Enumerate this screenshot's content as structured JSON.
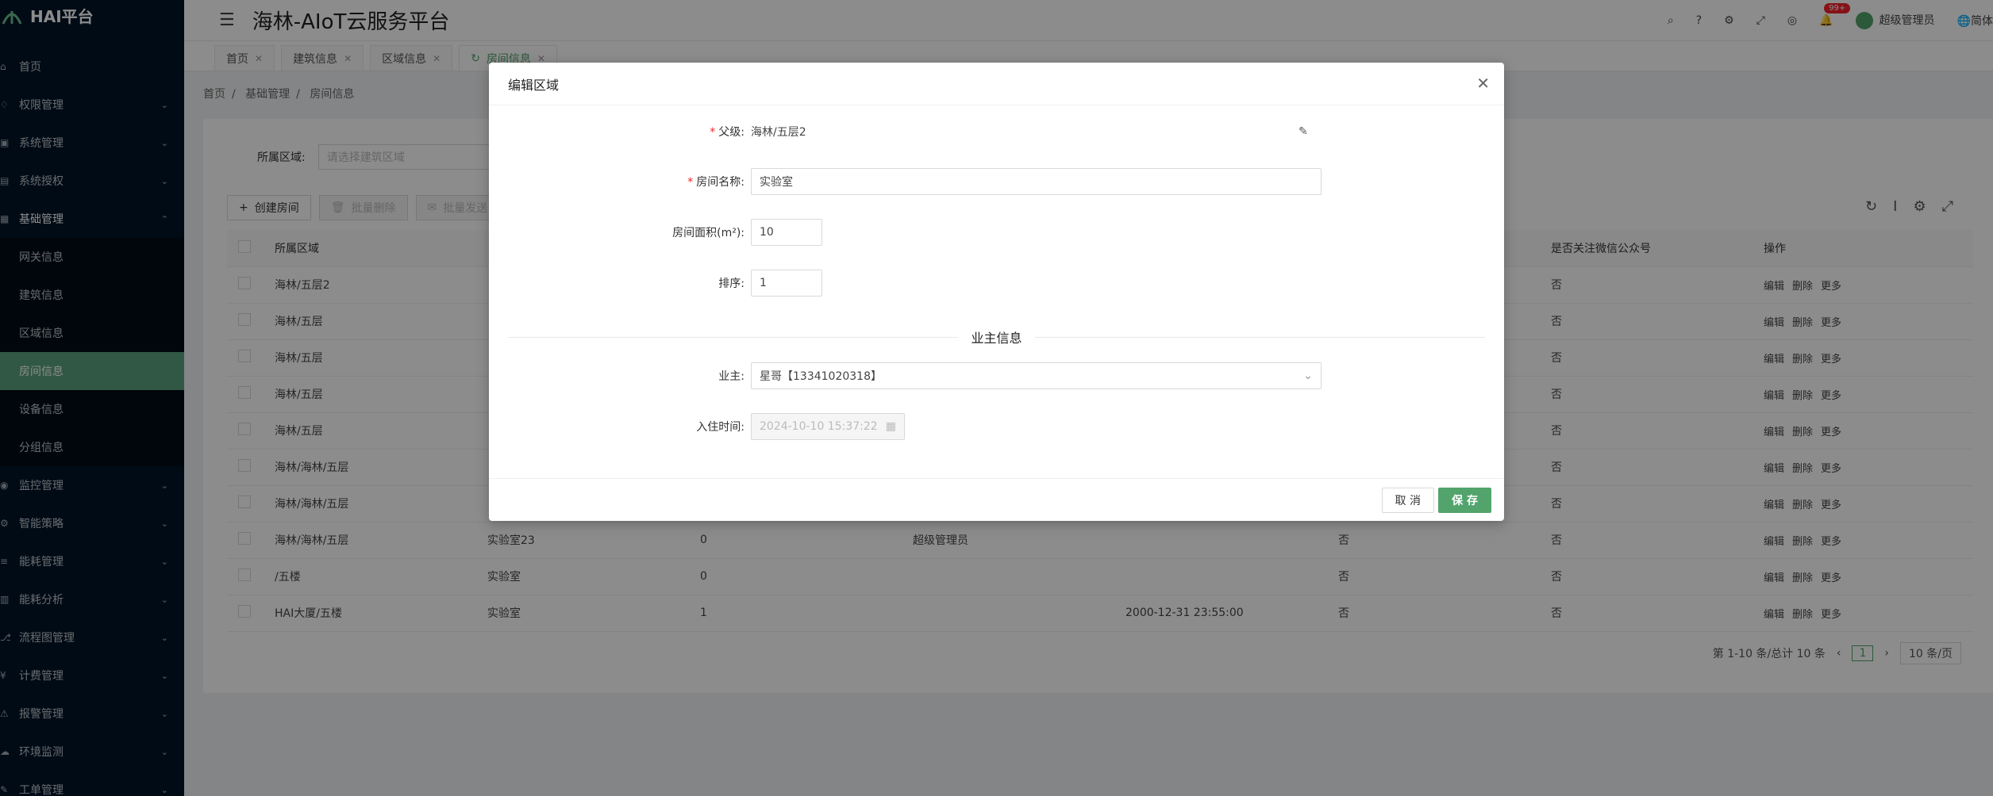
{
  "app": {
    "logo_text": "HAI平台",
    "title": "海林-AIoT云服务平台"
  },
  "header": {
    "user": "超级管理员",
    "notif_count": "99+",
    "lang": "简体"
  },
  "sidebar": {
    "items": [
      {
        "label": "首页"
      },
      {
        "label": "权限管理"
      },
      {
        "label": "系统管理"
      },
      {
        "label": "系统授权"
      },
      {
        "label": "基础管理"
      }
    ],
    "sub_items": [
      {
        "label": "网关信息"
      },
      {
        "label": "建筑信息"
      },
      {
        "label": "区域信息"
      },
      {
        "label": "房间信息"
      },
      {
        "label": "设备信息"
      },
      {
        "label": "分组信息"
      }
    ],
    "items_after": [
      {
        "label": "监控管理"
      },
      {
        "label": "智能策略"
      },
      {
        "label": "能耗管理"
      },
      {
        "label": "能耗分析"
      },
      {
        "label": "流程图管理"
      },
      {
        "label": "计费管理"
      },
      {
        "label": "报警管理"
      },
      {
        "label": "环境监测"
      },
      {
        "label": "工单管理"
      }
    ]
  },
  "tabs": [
    {
      "label": "首页"
    },
    {
      "label": "建筑信息"
    },
    {
      "label": "区域信息"
    },
    {
      "label": "房间信息"
    }
  ],
  "breadcrumb": [
    "首页",
    "基础管理",
    "房间信息"
  ],
  "search": {
    "label": "所属区域:",
    "placeholder": "请选择建筑区域"
  },
  "toolbar": {
    "create": "创建房间",
    "batch_delete": "批量删除",
    "batch_notify": "批量发送"
  },
  "table": {
    "headers": [
      "所属区域",
      "",
      "",
      "",
      "",
      "",
      "是否关注微信公众号",
      "操作"
    ],
    "rows": [
      {
        "area": "海林/五层2",
        "name": "",
        "count": "",
        "owner": "",
        "time": "",
        "flag": "",
        "wechat": "否"
      },
      {
        "area": "海林/五层",
        "name": "",
        "count": "",
        "owner": "",
        "time": "",
        "flag": "",
        "wechat": "否"
      },
      {
        "area": "海林/五层",
        "name": "",
        "count": "",
        "owner": "",
        "time": "",
        "flag": "",
        "wechat": "否"
      },
      {
        "area": "海林/五层",
        "name": "",
        "count": "",
        "owner": "",
        "time": "",
        "flag": "",
        "wechat": "否"
      },
      {
        "area": "海林/五层",
        "name": "",
        "count": "",
        "owner": "",
        "time": "",
        "flag": "",
        "wechat": "否"
      },
      {
        "area": "海林/海林/五层",
        "name": "",
        "count": "",
        "owner": "",
        "time": "",
        "flag": "",
        "wechat": "否"
      },
      {
        "area": "海林/海林/五层",
        "name": "",
        "count": "",
        "owner": "",
        "time": "",
        "flag": "",
        "wechat": "否"
      },
      {
        "area": "海林/海林/五层",
        "name": "实验室23",
        "count": "0",
        "owner": "超级管理员",
        "time": "",
        "flag": "否",
        "wechat": "否"
      },
      {
        "area": "/五楼",
        "name": "实验室",
        "count": "0",
        "owner": "",
        "time": "",
        "flag": "否",
        "wechat": "否"
      },
      {
        "area": "HAI大厦/五楼",
        "name": "实验室",
        "count": "1",
        "owner": "",
        "time": "2000-12-31 23:55:00",
        "flag": "否",
        "wechat": "否"
      }
    ],
    "ops": {
      "edit": "编辑",
      "delete": "删除",
      "more": "更多"
    }
  },
  "pager": {
    "summary": "第 1-10 条/总计 10 条",
    "current": "1",
    "size": "10 条/页"
  },
  "modal": {
    "title": "编辑区域",
    "parent_label": "父级:",
    "parent_value": "海林/五层2",
    "room_name_label": "房间名称:",
    "room_name_value": "实验室",
    "area_label": "房间面积(m²):",
    "area_value": "10",
    "sort_label": "排序:",
    "sort_value": "1",
    "section_title": "业主信息",
    "owner_label": "业主:",
    "owner_value": "星哥【13341020318】",
    "checkin_label": "入住时间:",
    "checkin_value": "2024-10-10 15:37:22",
    "cancel": "取 消",
    "save": "保 存"
  }
}
